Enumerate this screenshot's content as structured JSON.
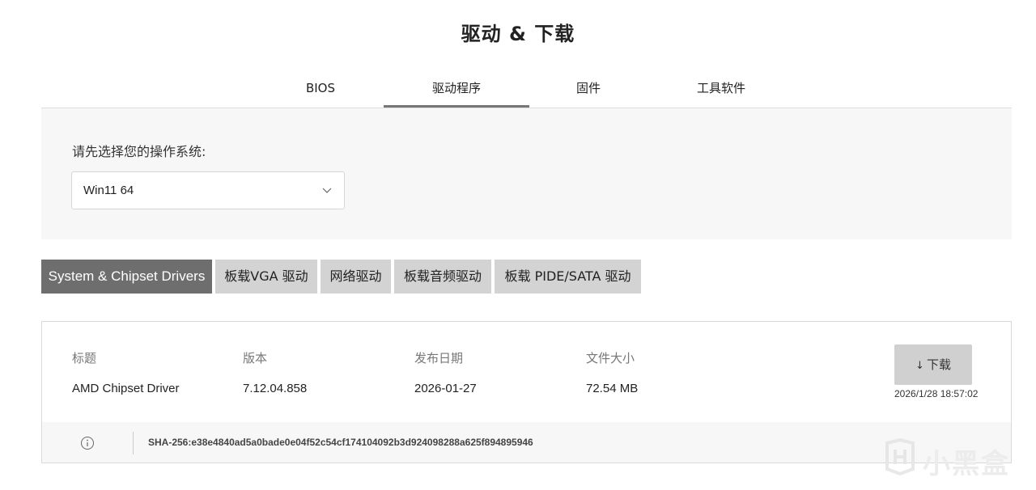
{
  "header": {
    "title": "驱动 & 下载"
  },
  "tabs": [
    {
      "label": "BIOS",
      "active": false
    },
    {
      "label": "驱动程序",
      "active": true
    },
    {
      "label": "固件",
      "active": false
    },
    {
      "label": "工具软件",
      "active": false
    }
  ],
  "os_select": {
    "label": "请先选择您的操作系统:",
    "value": "Win11 64"
  },
  "categories": [
    {
      "label": "System & Chipset Drivers",
      "active": true
    },
    {
      "label": "板载VGA 驱动",
      "active": false
    },
    {
      "label": "网络驱动",
      "active": false
    },
    {
      "label": "板载音频驱动",
      "active": false
    },
    {
      "label": "板载 PIDE/SATA 驱动",
      "active": false
    }
  ],
  "driver": {
    "columns": [
      "标题",
      "版本",
      "发布日期",
      "文件大小"
    ],
    "title": "AMD Chipset Driver",
    "version": "7.12.04.858",
    "release_date": "2026-01-27",
    "file_size": "72.54 MB",
    "download_label": "下载",
    "download_arrow": "↓",
    "timestamp": "2026/1/28 18:57:02",
    "hash": "SHA-256:e38e4840ad5a0bade0e04f52c54cf174104092b3d924098288a625f894895946"
  },
  "watermark": {
    "text": "小黑盒"
  },
  "colors": {
    "active_category": "#6e6e6e",
    "inactive_category": "#d3d3d3",
    "panel_bg": "#f7f7f7",
    "active_tab_underline": "#777777"
  }
}
